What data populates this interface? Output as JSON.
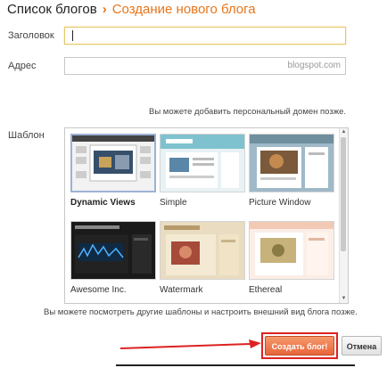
{
  "breadcrumb": {
    "root": "Список блогов",
    "separator": "›",
    "current": "Создание нового блога"
  },
  "form": {
    "title_label": "Заголовок",
    "title_value": "",
    "address_label": "Адрес",
    "address_value": "",
    "address_suffix": "blogspot.com",
    "domain_note": "Вы можете добавить персональный домен позже.",
    "template_label": "Шаблон",
    "templates_note": "Вы можете посмотреть другие шаблоны и настроить внешний вид блога позже."
  },
  "templates": [
    {
      "name": "Dynamic Views",
      "selected": true
    },
    {
      "name": "Simple",
      "selected": false
    },
    {
      "name": "Picture Window",
      "selected": false
    },
    {
      "name": "Awesome Inc.",
      "selected": false
    },
    {
      "name": "Watermark",
      "selected": false
    },
    {
      "name": "Ethereal",
      "selected": false
    }
  ],
  "buttons": {
    "create": "Создать блог!",
    "cancel": "Отмена"
  },
  "colors": {
    "accent": "#e8751a",
    "highlight": "#dd2222"
  }
}
